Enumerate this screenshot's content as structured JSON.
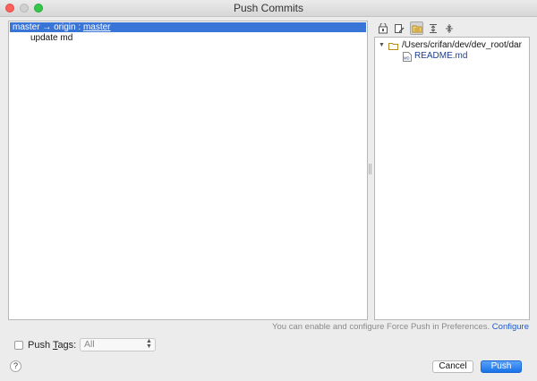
{
  "window": {
    "title": "Push Commits"
  },
  "commits_tree": {
    "branch": {
      "local": "master",
      "arrow": "→",
      "remote": "origin",
      "separator": ":",
      "target": "master"
    },
    "commit": {
      "message": "update md"
    }
  },
  "changes_toolbar": {
    "icons": [
      "show-diff-icon",
      "edit-source-icon",
      "group-by-directory-icon",
      "expand-all-icon",
      "collapse-all-icon"
    ],
    "active_icon": "group-by-directory-icon"
  },
  "changes_tree": {
    "root_path": "/Users/crifan/dev/dev_root/dar",
    "file": {
      "name": "README.md",
      "badge": "MD"
    }
  },
  "force_push": {
    "note": "You can enable and configure Force Push in Preferences.",
    "link": "Configure"
  },
  "push_tags": {
    "checked": false,
    "label_prefix": "Push ",
    "label_mnemonic": "T",
    "label_suffix": "ags:",
    "selected": "All"
  },
  "buttons": {
    "help": "?",
    "cancel": "Cancel",
    "push": "Push"
  },
  "colors": {
    "selection": "#3875d7",
    "link": "#1c5ad1",
    "push_button": "#1a73e8",
    "file_name": "#1b3d8f"
  }
}
